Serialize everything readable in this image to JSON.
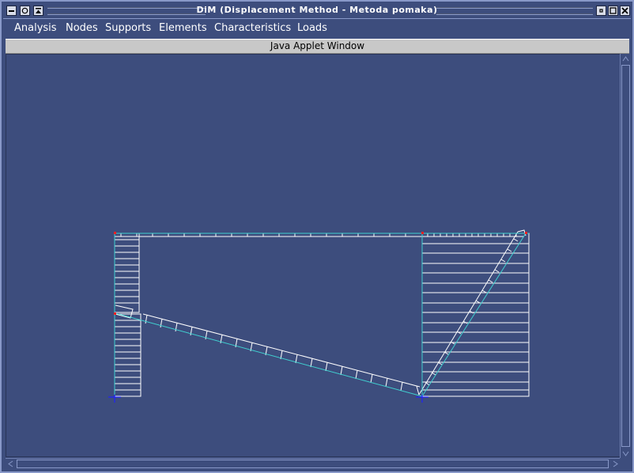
{
  "window": {
    "title": "DiM (Displacement Method - Metoda pomaka)"
  },
  "menu": {
    "items": [
      {
        "label": "Analysis"
      },
      {
        "label": "Nodes"
      },
      {
        "label": "Supports"
      },
      {
        "label": "Elements"
      },
      {
        "label": "Characteristics"
      },
      {
        "label": "Loads"
      }
    ]
  },
  "applet": {
    "banner": "Java Applet Window"
  },
  "colors": {
    "background": "#3d4d7d",
    "member": "#40d0d0",
    "hatch": "#ffffff",
    "node": "#ff2020",
    "support": "#2020ff"
  },
  "icons": {
    "minimize": "minimize-icon",
    "menu": "window-menu-icon",
    "shade": "shade-icon",
    "iconify": "iconify-icon",
    "maximize": "maximize-icon",
    "close": "close-icon"
  }
}
